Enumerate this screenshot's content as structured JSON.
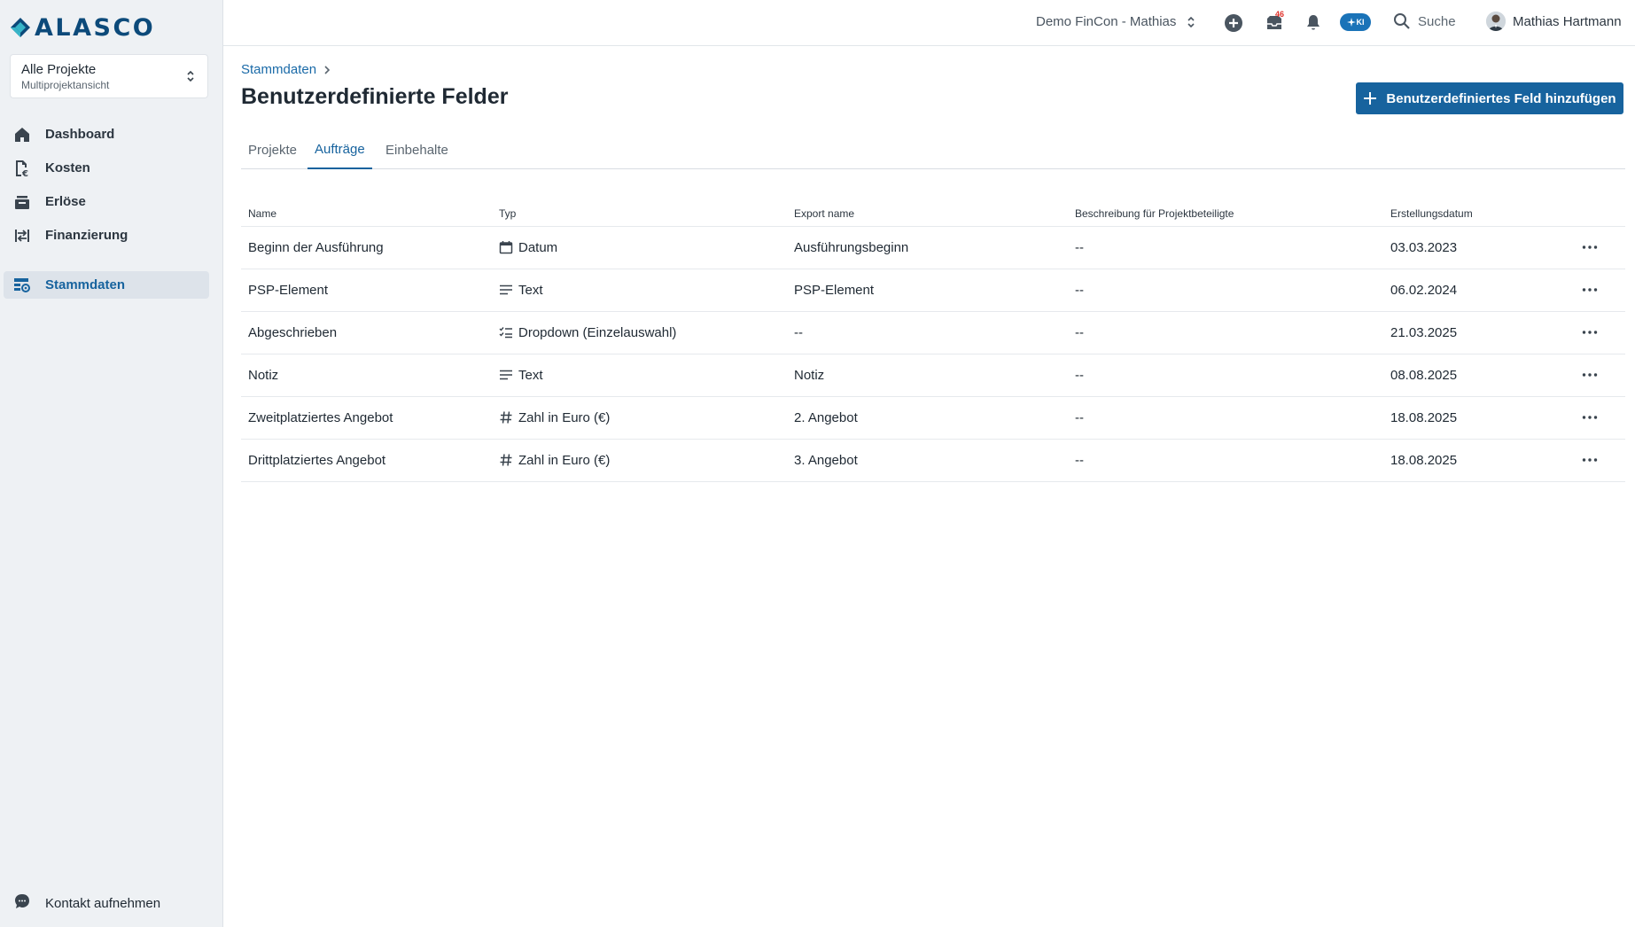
{
  "app": {
    "logo_text": "ALASCO",
    "project_select": {
      "title": "Alle Projekte",
      "subtitle": "Multiprojektansicht"
    },
    "nav": [
      {
        "label": "Dashboard",
        "icon": "home-icon"
      },
      {
        "label": "Kosten",
        "icon": "cost-icon"
      },
      {
        "label": "Erlöse",
        "icon": "revenue-icon"
      },
      {
        "label": "Finanzierung",
        "icon": "financing-icon"
      },
      {
        "label": "Stammdaten",
        "icon": "master-data-icon",
        "active": true
      }
    ],
    "contact_label": "Kontakt aufnehmen"
  },
  "topbar": {
    "workspace": "Demo FinCon - Mathias",
    "inbox_badge": "46",
    "ki_label": "KI",
    "search_label": "Suche",
    "user_name": "Mathias Hartmann"
  },
  "page": {
    "breadcrumb": "Stammdaten",
    "title": "Benutzerdefinierte Felder",
    "add_button": "Benutzerdefiniertes Feld hinzufügen",
    "tabs": [
      {
        "label": "Projekte"
      },
      {
        "label": "Aufträge",
        "active": true
      },
      {
        "label": "Einbehalte"
      }
    ]
  },
  "table": {
    "columns": [
      "Name",
      "Typ",
      "Export name",
      "Beschreibung für Projektbeteiligte",
      "Erstellungsdatum"
    ],
    "rows": [
      {
        "name": "Beginn der Ausführung",
        "type": "Datum",
        "type_icon": "calendar-icon",
        "export": "Ausführungsbeginn",
        "description": "--",
        "date": "03.03.2023"
      },
      {
        "name": "PSP-Element",
        "type": "Text",
        "type_icon": "text-lines-icon",
        "export": "PSP-Element",
        "description": "--",
        "date": "06.02.2024"
      },
      {
        "name": "Abgeschrieben",
        "type": "Dropdown (Einzelauswahl)",
        "type_icon": "checklist-icon",
        "export": "--",
        "description": "--",
        "date": "21.03.2025"
      },
      {
        "name": "Notiz",
        "type": "Text",
        "type_icon": "text-lines-icon",
        "export": "Notiz",
        "description": "--",
        "date": "08.08.2025"
      },
      {
        "name": "Zweitplatziertes Angebot",
        "type": "Zahl in Euro (€)",
        "type_icon": "hash-icon",
        "export": "2. Angebot",
        "description": "--",
        "date": "18.08.2025"
      },
      {
        "name": "Drittplatziertes Angebot",
        "type": "Zahl in Euro (€)",
        "type_icon": "hash-icon",
        "export": "3. Angebot",
        "description": "--",
        "date": "18.08.2025"
      }
    ]
  },
  "colors": {
    "brand": "#17639e",
    "sidebar_bg": "#eef1f4",
    "badge": "#e0312a"
  }
}
